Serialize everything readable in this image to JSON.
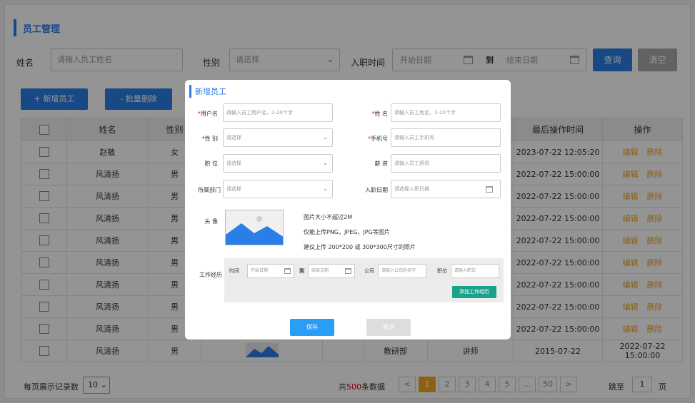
{
  "page_title": "员工管理",
  "filters": {
    "name_label": "姓名",
    "name_placeholder": "请输入员工姓名",
    "gender_label": "性别",
    "gender_value": "请选择",
    "hire_date_label": "入职时间",
    "start_placeholder": "开始日期",
    "to_label": "到",
    "end_placeholder": "结束日期",
    "query_label": "查询",
    "clear_label": "清空"
  },
  "actions": {
    "add_label": "+ 新增员工",
    "batch_delete_label": "- 批量删除"
  },
  "table": {
    "headers": [
      "",
      "姓名",
      "性别",
      "",
      "",
      "",
      "",
      "最后操作时间",
      "操作"
    ],
    "rows": [
      {
        "name": "赵敏",
        "gender": "女",
        "dept": "",
        "title": "",
        "hire_date": "",
        "last_op": "2023-07-22 12:05:20"
      },
      {
        "name": "风清扬",
        "gender": "男",
        "dept": "",
        "title": "",
        "hire_date": "",
        "last_op": "2022-07-22 15:00:00"
      },
      {
        "name": "风清扬",
        "gender": "男",
        "dept": "",
        "title": "",
        "hire_date": "",
        "last_op": "2022-07-22 15:00:00"
      },
      {
        "name": "风清扬",
        "gender": "男",
        "dept": "",
        "title": "",
        "hire_date": "",
        "last_op": "2022-07-22 15:00:00"
      },
      {
        "name": "风清扬",
        "gender": "男",
        "dept": "",
        "title": "",
        "hire_date": "",
        "last_op": "2022-07-22 15:00:00"
      },
      {
        "name": "风清扬",
        "gender": "男",
        "dept": "",
        "title": "",
        "hire_date": "",
        "last_op": "2022-07-22 15:00:00"
      },
      {
        "name": "风清扬",
        "gender": "男",
        "dept": "",
        "title": "",
        "hire_date": "",
        "last_op": "2022-07-22 15:00:00"
      },
      {
        "name": "风清扬",
        "gender": "男",
        "dept": "",
        "title": "",
        "hire_date": "",
        "last_op": "2022-07-22 15:00:00"
      },
      {
        "name": "风清扬",
        "gender": "男",
        "dept": "",
        "title": "",
        "hire_date": "",
        "last_op": "2022-07-22 15:00:00"
      },
      {
        "name": "风清扬",
        "gender": "男",
        "dept": "教研部",
        "title": "讲师",
        "hire_date": "2015-07-22",
        "last_op": "2022-07-22 15:00:00"
      }
    ],
    "edit_label": "编辑",
    "delete_label": "删除"
  },
  "footer": {
    "per_page_label": "每页展示记录数",
    "per_page_value": "10",
    "total_prefix": "共",
    "total_count": "500",
    "total_suffix": "条数据",
    "pages": [
      "<",
      "1",
      "2",
      "3",
      "4",
      "5",
      "...",
      "50",
      ">"
    ],
    "active_page": "1",
    "jump_label": "跳至",
    "jump_value": "1",
    "jump_unit": "页"
  },
  "modal": {
    "title": "新增员工",
    "username_label": "用户名",
    "username_placeholder": "请输入员工用户名，2-20个字",
    "name_label": "姓  名",
    "name_placeholder": "请输入员工姓名，2-10个字",
    "gender_label": "性  别",
    "gender_placeholder": "请选择",
    "phone_label": "手机号",
    "phone_placeholder": "请输入员工手机号",
    "position_label": "职  位",
    "position_placeholder": "请选择",
    "salary_label": "薪  资",
    "salary_placeholder": "请输入员工薪资",
    "dept_label": "所属部门",
    "dept_placeholder": "请选择",
    "hire_label": "入职日期",
    "hire_placeholder": "请选择入职日期",
    "avatar_label": "头  像",
    "hint_1": "图片大小不超过2M",
    "hint_2": "仅能上传PNG，JPEG，JPG等图片",
    "hint_3": "建议上传 200*200 或 300*300尺寸的照片",
    "work_label": "工作经历",
    "work_time_label": "时间",
    "work_start_placeholder": "开始日期",
    "work_to_label": "到",
    "work_end_placeholder": "结束日期",
    "work_company_label": "公司",
    "work_company_placeholder": "请输入公司的名字",
    "work_position_label": "职位",
    "work_position_placeholder": "请输入职位",
    "add_work_label": "添加工作经历",
    "save_label": "保存",
    "cancel_label": "取消"
  },
  "colors": {
    "primary": "#2a7ee6",
    "operation": "#f5a623",
    "add_work": "#1aa38a"
  }
}
